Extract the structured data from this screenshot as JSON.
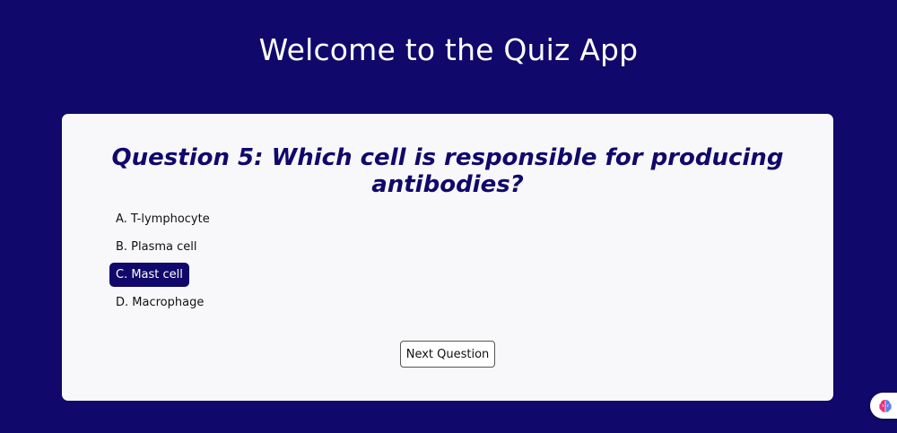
{
  "app": {
    "title": "Welcome to the Quiz App"
  },
  "quiz": {
    "question": "Question 5: Which cell is responsible for producing antibodies?",
    "options": [
      {
        "label": "A. T-lymphocyte",
        "selected": false
      },
      {
        "label": "B. Plasma cell",
        "selected": false
      },
      {
        "label": "C. Mast cell",
        "selected": true
      },
      {
        "label": "D. Macrophage",
        "selected": false
      }
    ],
    "next_label": "Next Question"
  },
  "widget": {
    "icon": "brain-icon"
  },
  "colors": {
    "background": "#10096b",
    "card": "#f8f8fb",
    "accent": "#10096b",
    "widget_pink": "#e9327a",
    "widget_blue": "#5b7cf0"
  }
}
